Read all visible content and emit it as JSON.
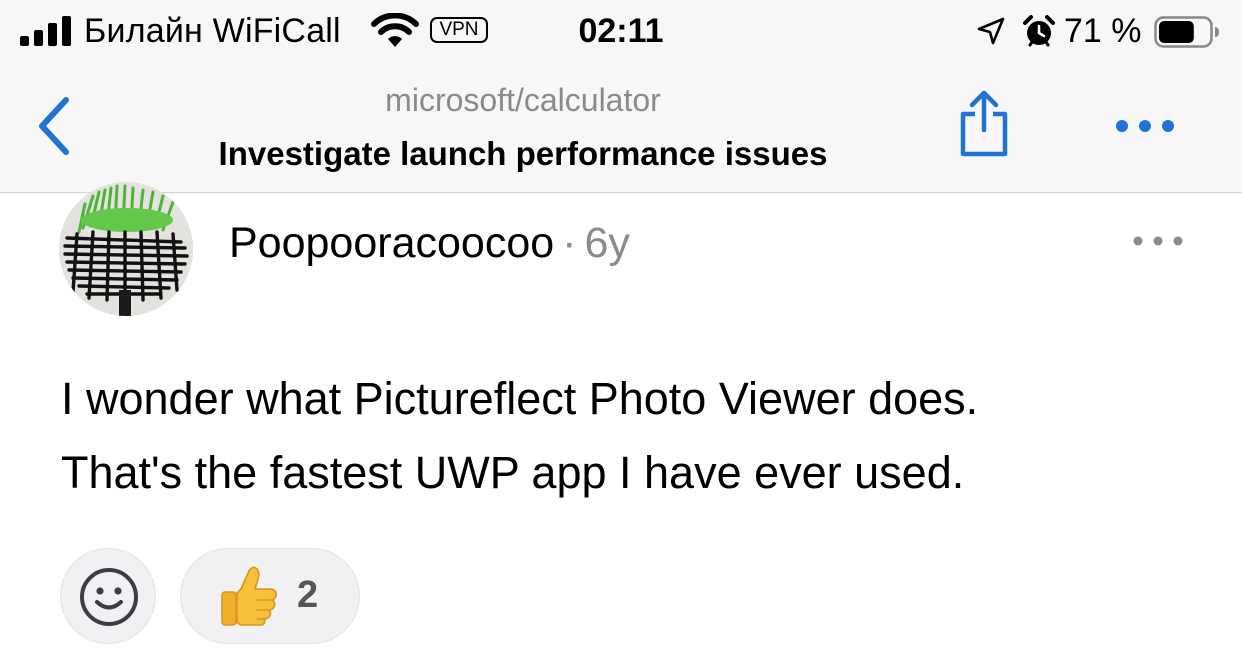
{
  "status_bar": {
    "carrier": "Билайн WiFiCall",
    "vpn_label": "VPN",
    "time": "02:11",
    "battery_percent": "71 %",
    "battery_level": 0.71,
    "icons": [
      "signal-icon",
      "wifi-icon",
      "location-arrow-icon",
      "alarm-icon",
      "battery-icon"
    ]
  },
  "nav": {
    "repo": "microsoft/calculator",
    "title": "Investigate launch performance issues",
    "icons": [
      "back-chevron-icon",
      "share-icon",
      "more-horizontal-icon"
    ],
    "accent_color": "#1f73d2"
  },
  "comment": {
    "author": "Poopooracoocoo",
    "separator": "·",
    "age": "6y",
    "body_lines": [
      "I wonder what Pictureflect Photo Viewer does.",
      "That's the fastest UWP app I have ever used."
    ],
    "reactions": [
      {
        "icon": "thumbs-up-icon",
        "count": "2"
      }
    ],
    "add_reaction_icon": "smiley-icon"
  }
}
